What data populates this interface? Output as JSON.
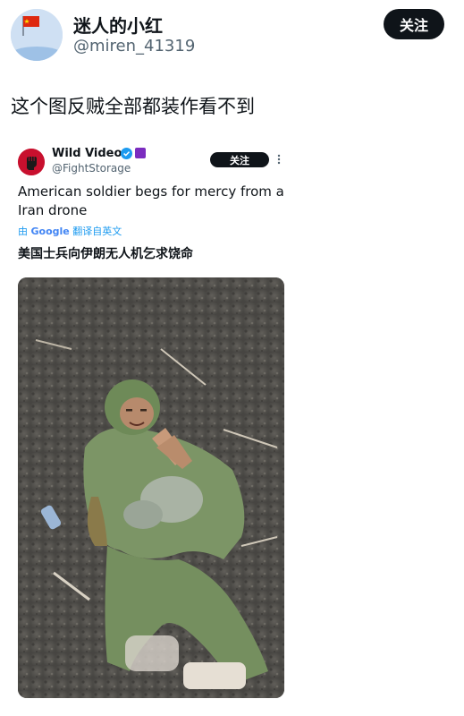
{
  "author": {
    "display_name": "迷人的小红",
    "handle": "@miren_41319",
    "follow_label": "关注",
    "avatar_icon": "red-flag-avatar"
  },
  "post": {
    "text": "这个图反贼全部都装作看不到"
  },
  "quoted": {
    "display_name": "Wild Videos",
    "handle": "@FightStorage",
    "follow_label": "关注",
    "verified_icon": "verified-badge-icon",
    "avatar_icon": "raised-fist-avatar",
    "text": "American soldier begs for mercy from a Iran drone",
    "translated_by_prefix": "由",
    "translated_by_brand": "Google",
    "translated_by_suffix": "翻译自英文",
    "translation": "美国士兵向伊朗无人机乞求饶命",
    "media_icon": "soldier-photo"
  },
  "colors": {
    "link_blue": "#1d9bf0",
    "text_primary": "#0f1419",
    "text_secondary": "#536471",
    "button_black": "#0f1419"
  }
}
